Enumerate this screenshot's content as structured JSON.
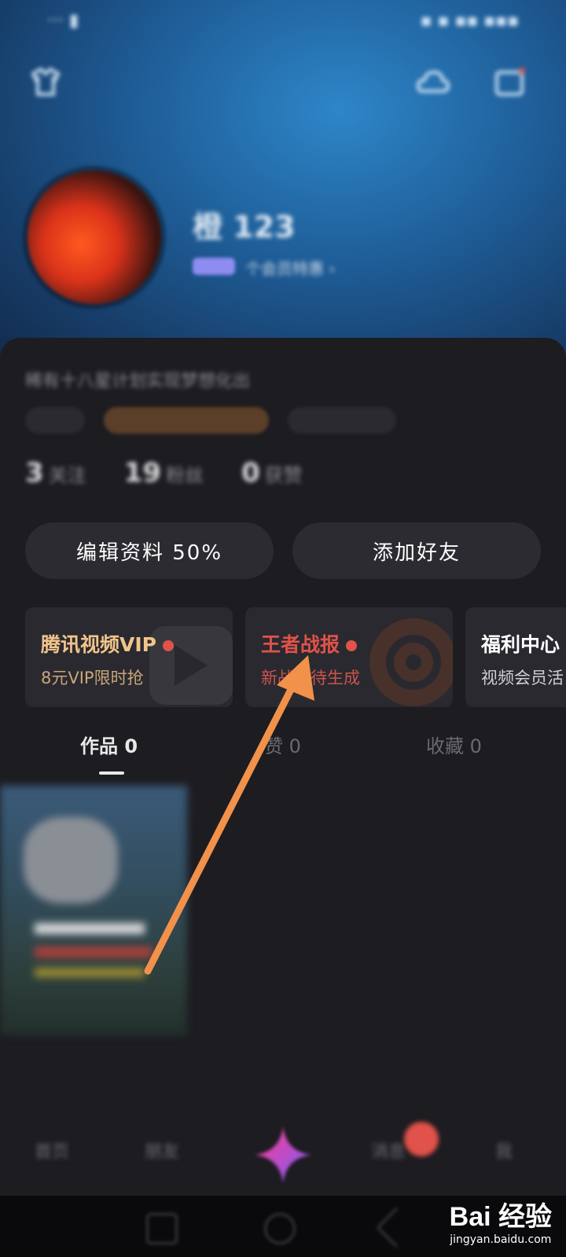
{
  "profile": {
    "username": "橙 123",
    "level_text": "个会员特惠 ›"
  },
  "bio": "稀有十八星计划实现梦想化出",
  "stats": [
    {
      "value": "3",
      "label": "关注"
    },
    {
      "value": "19",
      "label": "粉丝"
    },
    {
      "value": "0",
      "label": "获赞"
    }
  ],
  "actions": {
    "edit_profile": "编辑资料 50%",
    "add_friend": "添加好友"
  },
  "promos": [
    {
      "title": "腾讯视频VIP",
      "subtitle": "8元VIP限时抢",
      "title_color": "#f1c58a",
      "subtitle_color": "#c9a679"
    },
    {
      "title": "王者战报",
      "subtitle": "新战报待生成",
      "title_color": "#e0524a",
      "subtitle_color": "#c9544c"
    },
    {
      "title": "福利中心",
      "subtitle": "视频会员活",
      "title_color": "#ffffff",
      "subtitle_color": "#cfcfd3"
    }
  ],
  "tabs": [
    {
      "label": "作品 0",
      "active": true
    },
    {
      "label": "赞 0",
      "active": false
    },
    {
      "label": "收藏 0",
      "active": false
    }
  ],
  "bottom_nav": [
    "首页",
    "朋友",
    "消息",
    "我"
  ],
  "watermark": {
    "logo": "Bai 经验",
    "url": "jingyan.baidu.com"
  },
  "colors": {
    "accent_arrow": "#f2914a",
    "background": "#1d1c21",
    "red_dot": "#e0524a"
  }
}
